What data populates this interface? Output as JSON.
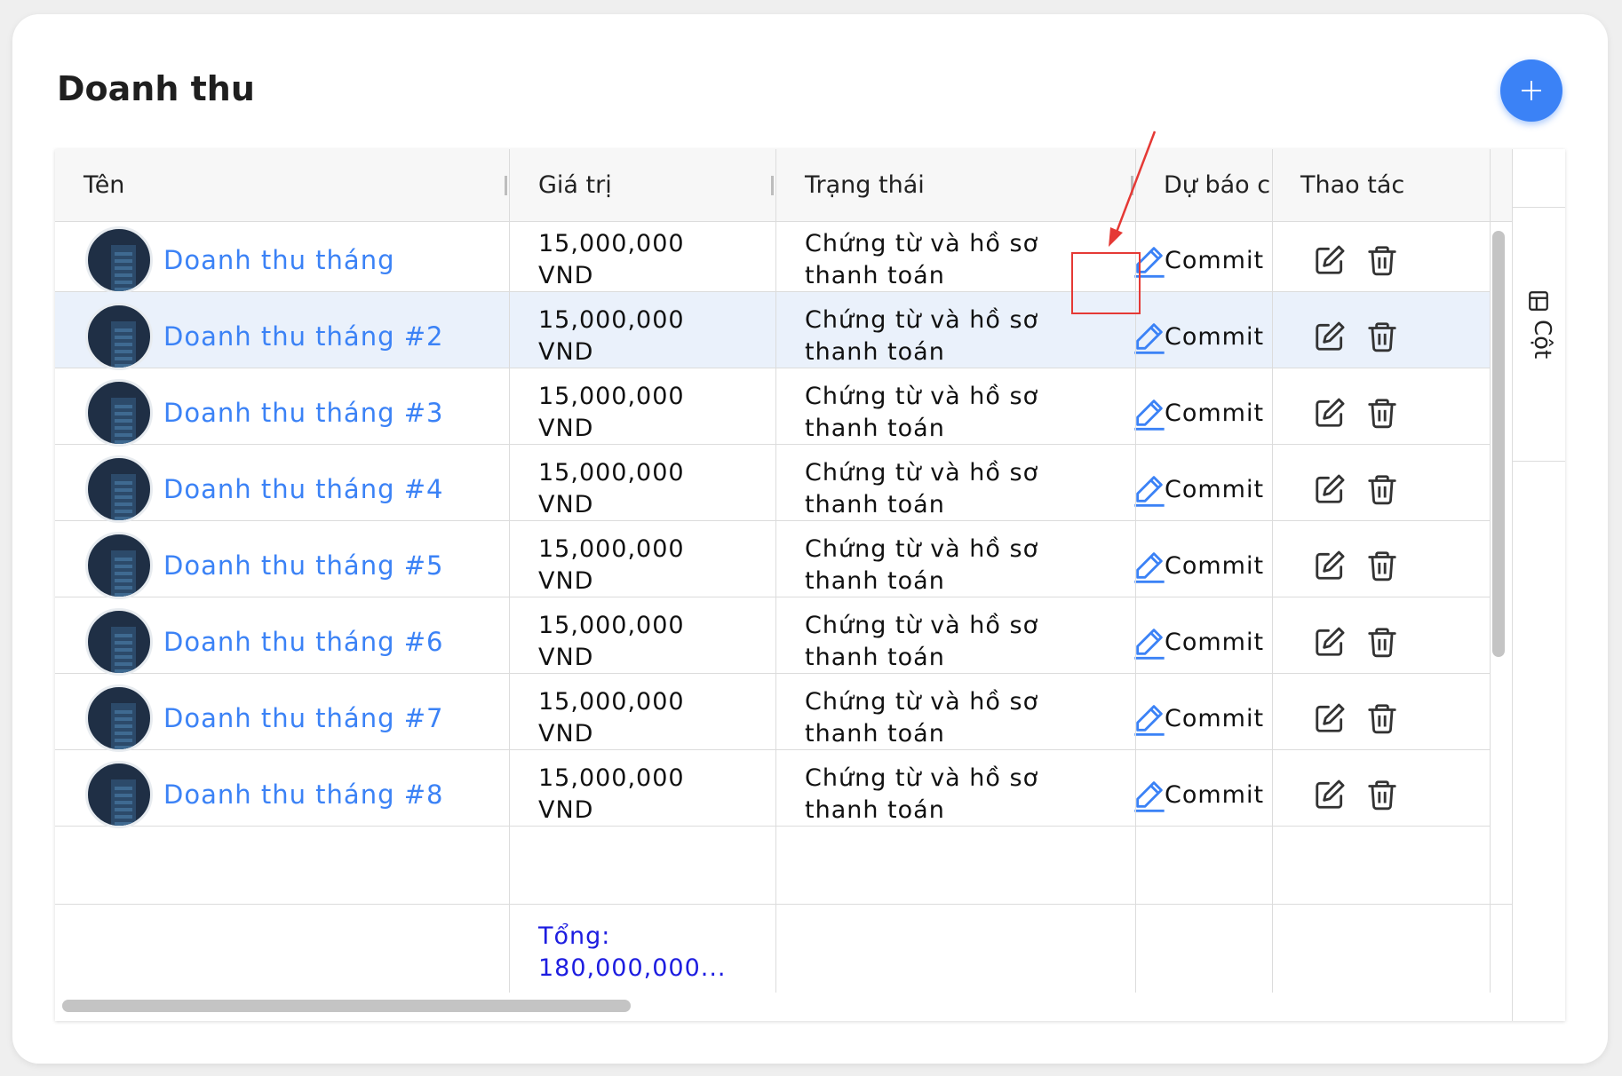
{
  "page": {
    "title": "Doanh thu"
  },
  "columns": {
    "name": "Tên",
    "value": "Giá trị",
    "status": "Trạng thái",
    "forecast": "Dự báo c",
    "actions": "Thao tác"
  },
  "side_panel": {
    "label": "Cột"
  },
  "rows": [
    {
      "name": "Doanh thu tháng",
      "value_line1": "15,000,000",
      "value_line2": "VND",
      "status_line1": "Chứng từ và hồ sơ",
      "status_line2": "thanh toán",
      "forecast": "Commit"
    },
    {
      "name": "Doanh thu tháng #2",
      "value_line1": "15,000,000",
      "value_line2": "VND",
      "status_line1": "Chứng từ và hồ sơ",
      "status_line2": "thanh toán",
      "forecast": "Commit"
    },
    {
      "name": "Doanh thu tháng #3",
      "value_line1": "15,000,000",
      "value_line2": "VND",
      "status_line1": "Chứng từ và hồ sơ",
      "status_line2": "thanh toán",
      "forecast": "Commit"
    },
    {
      "name": "Doanh thu tháng #4",
      "value_line1": "15,000,000",
      "value_line2": "VND",
      "status_line1": "Chứng từ và hồ sơ",
      "status_line2": "thanh toán",
      "forecast": "Commit"
    },
    {
      "name": "Doanh thu tháng #5",
      "value_line1": "15,000,000",
      "value_line2": "VND",
      "status_line1": "Chứng từ và hồ sơ",
      "status_line2": "thanh toán",
      "forecast": "Commit"
    },
    {
      "name": "Doanh thu tháng #6",
      "value_line1": "15,000,000",
      "value_line2": "VND",
      "status_line1": "Chứng từ và hồ sơ",
      "status_line2": "thanh toán",
      "forecast": "Commit"
    },
    {
      "name": "Doanh thu tháng #7",
      "value_line1": "15,000,000",
      "value_line2": "VND",
      "status_line1": "Chứng từ và hồ sơ",
      "status_line2": "thanh toán",
      "forecast": "Commit"
    },
    {
      "name": "Doanh thu tháng #8",
      "value_line1": "15,000,000",
      "value_line2": "VND",
      "status_line1": "Chứng từ và hồ sơ",
      "status_line2": "thanh toán",
      "forecast": "Commit"
    }
  ],
  "footer": {
    "total_label": "Tổng:",
    "total_value": "180,000,000..."
  },
  "colors": {
    "accent": "#3b82f6",
    "selected_row": "#eaf1fb",
    "total_text": "#1d1de0",
    "annotation": "#e53935"
  },
  "icons": {
    "add": "plus-icon",
    "status_edit": "pencil-icon",
    "row_edit": "edit-square-icon",
    "row_delete": "trash-icon",
    "columns": "table-icon"
  },
  "selected_row_index": 1
}
